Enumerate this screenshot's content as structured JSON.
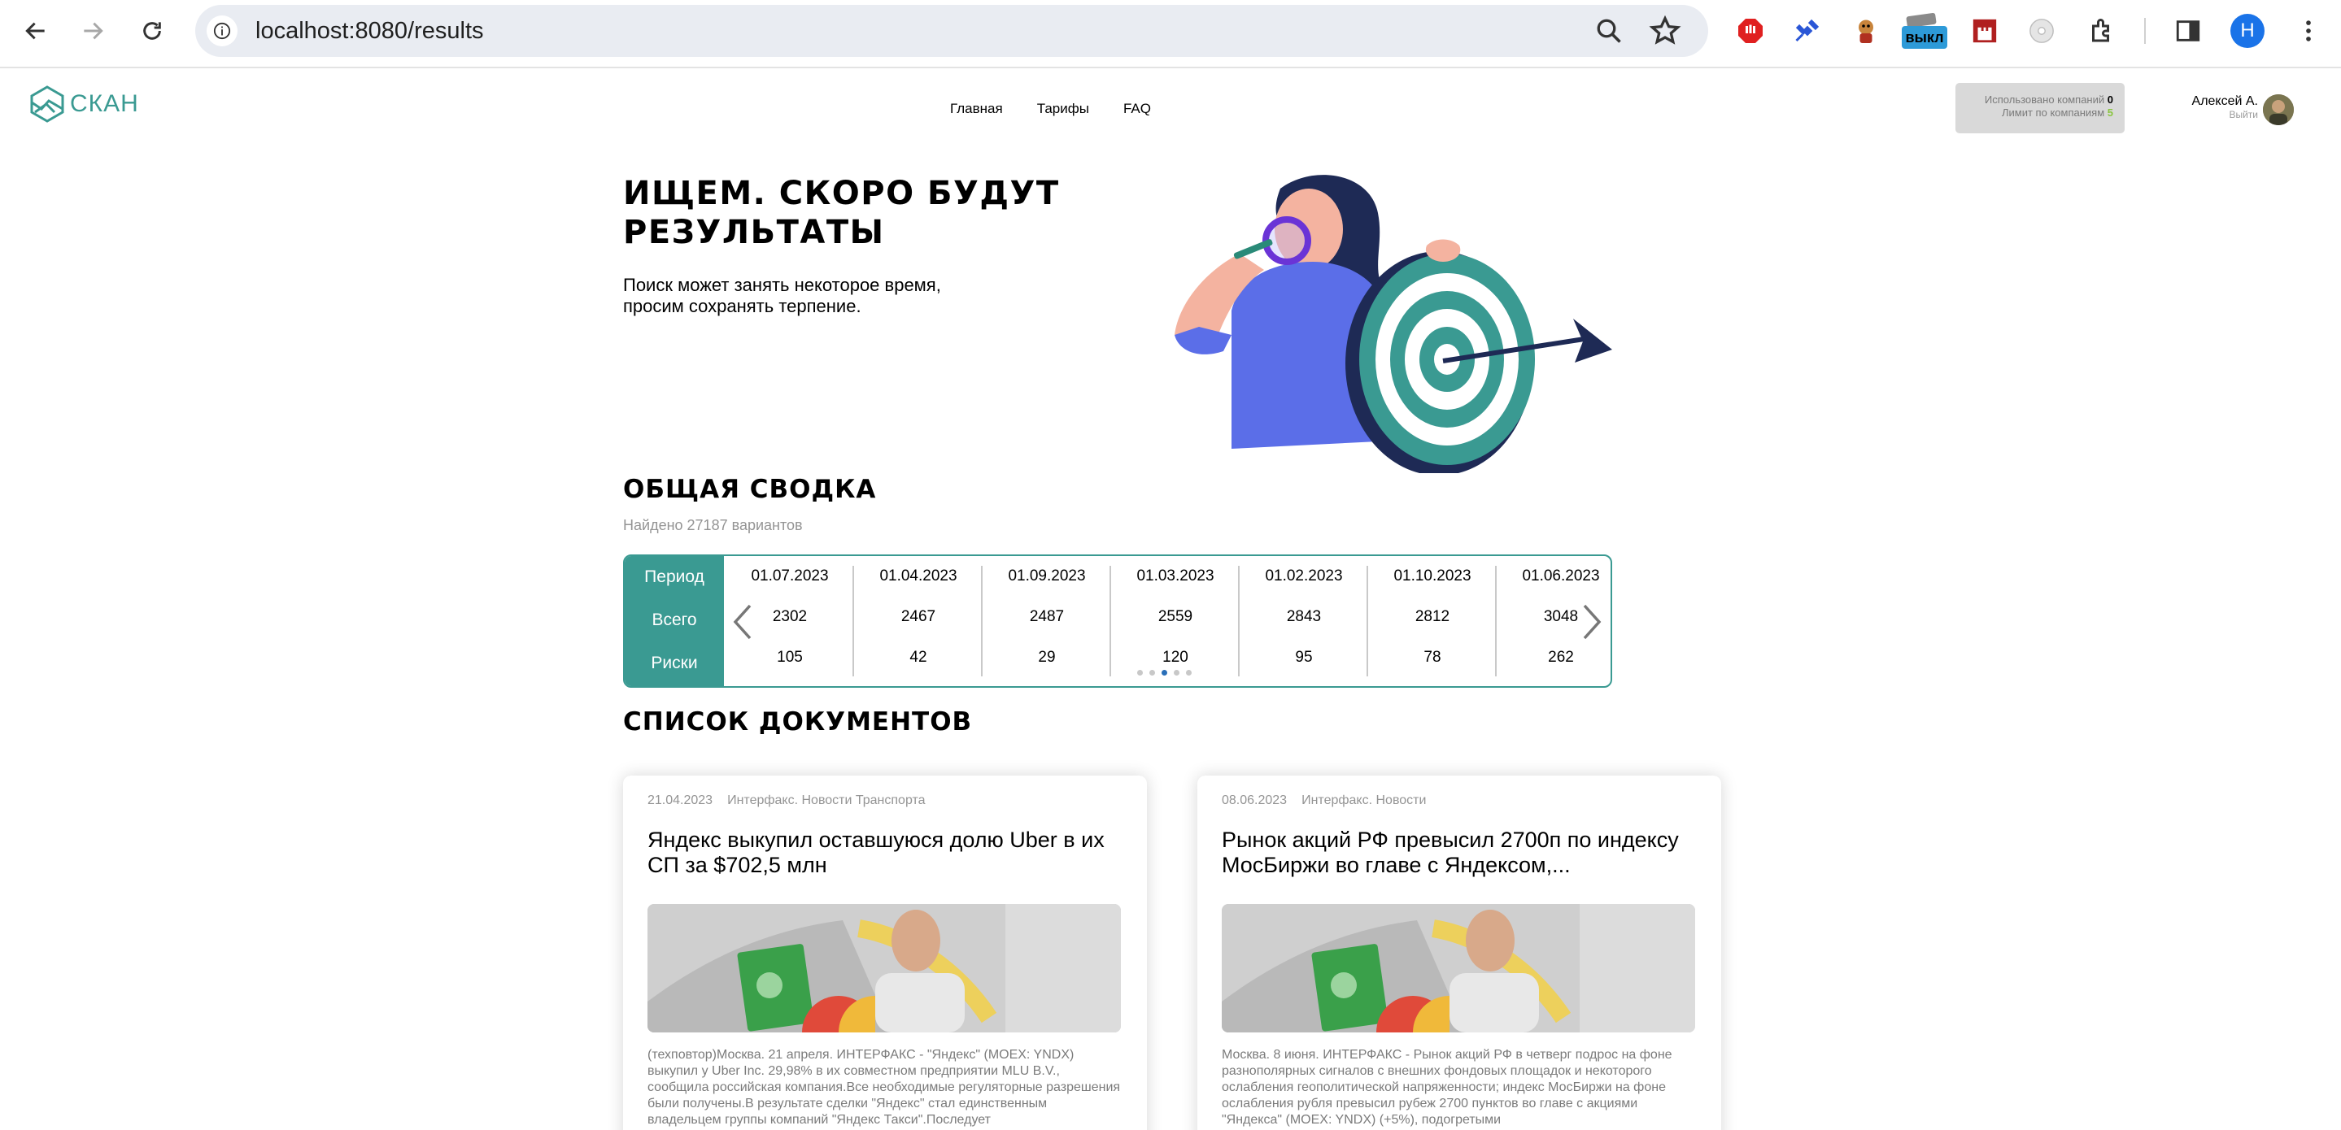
{
  "browser": {
    "url": "localhost:8080/results",
    "profile_initial": "H",
    "extension_badge": "выкл",
    "icons": [
      "back-icon",
      "forward-icon",
      "reload-icon",
      "info-icon",
      "zoom-icon",
      "star-icon",
      "extensions-icon",
      "sidepanel-icon",
      "menu-icon"
    ]
  },
  "header": {
    "logo_text": "СКАН",
    "nav": [
      "Главная",
      "Тарифы",
      "FAQ"
    ],
    "limits": {
      "used_label": "Использовано компаний",
      "used_value": "0",
      "limit_label": "Лимит по компаниям",
      "limit_value": "5"
    },
    "user": {
      "name": "Алексей А.",
      "logout": "Выйти"
    }
  },
  "hero": {
    "title": "ИЩЕМ. СКОРО БУДУТ РЕЗУЛЬТАТЫ",
    "subtitle": "Поиск может занять некоторое время, просим сохранять терпение."
  },
  "summary": {
    "title": "ОБЩАЯ СВОДКА",
    "found": "Найдено 27187 вариантов",
    "row_labels": [
      "Период",
      "Всего",
      "Риски"
    ],
    "columns": [
      {
        "period": "01.07.2023",
        "total": "2302",
        "risks": "105"
      },
      {
        "period": "01.04.2023",
        "total": "2467",
        "risks": "42"
      },
      {
        "period": "01.09.2023",
        "total": "2487",
        "risks": "29"
      },
      {
        "period": "01.03.2023",
        "total": "2559",
        "risks": "120"
      },
      {
        "period": "01.02.2023",
        "total": "2843",
        "risks": "95"
      },
      {
        "period": "01.10.2023",
        "total": "2812",
        "risks": "78"
      },
      {
        "period": "01.06.2023",
        "total": "3048",
        "risks": "262"
      }
    ],
    "pagination_dots": 5,
    "active_dot": 2
  },
  "documents": {
    "title": "СПИСОК ДОКУМЕНТОВ",
    "items": [
      {
        "date": "21.04.2023",
        "source": "Интерфакс. Новости Транспорта",
        "title": "Яндекс выкупил оставшуюся долю Uber в их СП за $702,5 млн",
        "text": "(техповтор)Москва. 21 апреля. ИНТЕРФАКС - \"Яндекс\" (MOEX: YNDX) выкупил у Uber Inc. 29,98% в их совместном предприятии MLU B.V., сообщила российская компания.Все необходимые регуляторные разрешения были получены.В результате сделки \"Яндекс\" стал единственным владельцем группы компаний \"Яндекс Такси\".Последует"
      },
      {
        "date": "08.06.2023",
        "source": "Интерфакс. Новости",
        "title": "Рынок акций РФ превысил 2700п по индексу МосБиржи во главе с Яндексом,...",
        "text": "Москва. 8 июня. ИНТЕРФАКС - Рынок акций РФ в четверг подрос на фоне разнополярных сигналов с внешних фондовых площадок и некоторого ослабления геополитической напряженности; индекс МосБиржи на фоне ослабления рубля превысил рубеж 2700 пунктов во главе с акциями \"Яндекса\" (MOEX: YNDX) (+5%), подогретыми"
      }
    ]
  },
  "colors": {
    "accent": "#3a9a92",
    "limit_value": "#8ac540",
    "muted_text": "#949494"
  }
}
